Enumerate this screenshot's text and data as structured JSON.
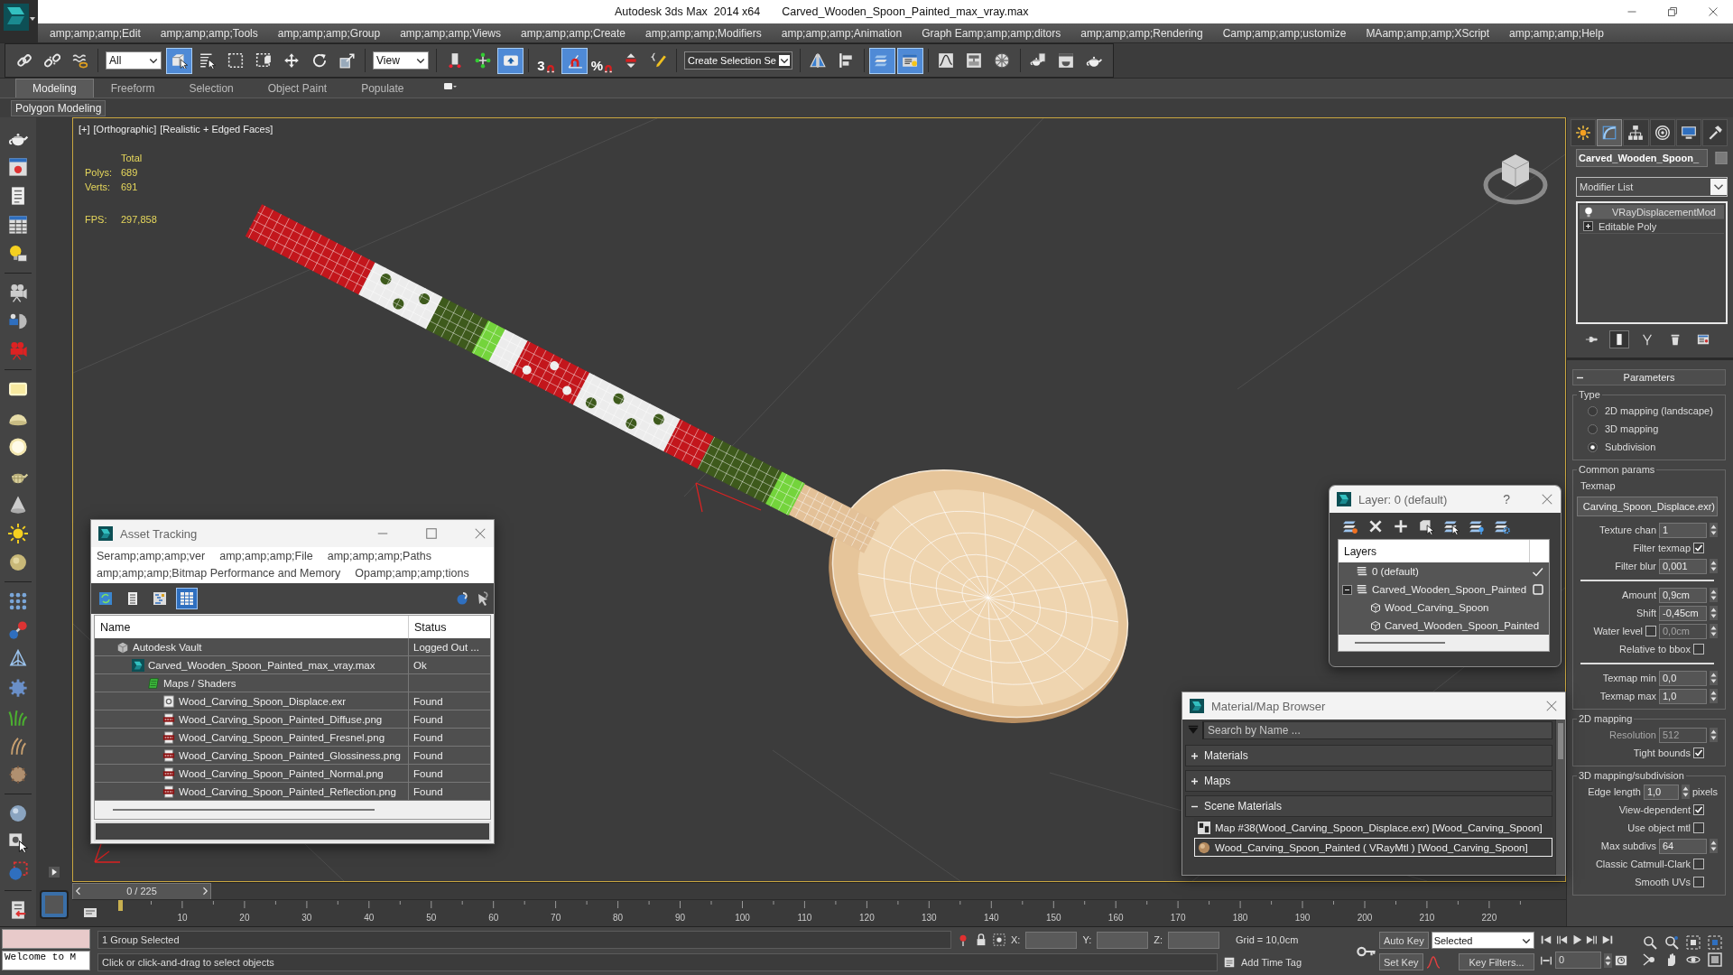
{
  "title_bar": {
    "app": "Autodesk 3ds Max  2014 x64",
    "file": "Carved_Wooden_Spoon_Painted_max_vray.max"
  },
  "menu": [
    "amp;amp;amp;Edit",
    "amp;amp;amp;Tools",
    "amp;amp;amp;Group",
    "amp;amp;amp;Views",
    "amp;amp;amp;Create",
    "amp;amp;amp;Modifiers",
    "amp;amp;amp;Animation",
    "Graph Eamp;amp;amp;ditors",
    "amp;amp;amp;Rendering",
    "Camp;amp;amp;ustomize",
    "MAamp;amp;amp;XScript",
    "amp;amp;amp;Help"
  ],
  "toolbar": [
    {
      "kind": "button",
      "selected": false
    },
    {
      "kind": "button",
      "selected": false
    },
    {
      "kind": "button",
      "selected": false
    },
    {
      "kind": "dropdown",
      "value": "All"
    },
    {
      "kind": "button",
      "selected": true
    },
    {
      "kind": "button",
      "selected": false
    },
    {
      "kind": "button",
      "selected": false
    },
    {
      "kind": "button",
      "selected": false
    },
    {
      "kind": "button",
      "selected": false
    },
    {
      "kind": "button",
      "selected": false
    },
    {
      "kind": "button",
      "selected": false
    },
    {
      "kind": "dropdown",
      "value": "View"
    },
    {
      "kind": "button",
      "selected": false
    },
    {
      "kind": "button",
      "selected": false
    },
    {
      "kind": "button",
      "selected": true
    },
    {
      "kind": "snap",
      "label": "3",
      "selected": false
    },
    {
      "kind": "button",
      "selected": true
    },
    {
      "kind": "snap",
      "label": "%",
      "selected": false
    },
    {
      "kind": "button",
      "selected": false
    },
    {
      "kind": "button",
      "selected": false
    },
    {
      "kind": "dropdown",
      "value": "Create Selection Se"
    },
    {
      "kind": "button",
      "selected": false
    },
    {
      "kind": "button",
      "selected": false
    },
    {
      "kind": "button",
      "selected": true
    },
    {
      "kind": "button",
      "selected": true
    },
    {
      "kind": "button",
      "selected": false
    },
    {
      "kind": "button",
      "selected": false
    },
    {
      "kind": "button",
      "selected": false
    },
    {
      "kind": "button",
      "selected": false
    },
    {
      "kind": "button",
      "selected": false
    },
    {
      "kind": "button",
      "selected": false
    }
  ],
  "ribbon": {
    "tabs": [
      {
        "label": "Modeling",
        "selected": true
      },
      {
        "label": "Freeform",
        "selected": false
      },
      {
        "label": "Selection",
        "selected": false
      },
      {
        "label": "Object Paint",
        "selected": false
      },
      {
        "label": "Populate",
        "selected": false
      }
    ],
    "panel": "Polygon Modeling"
  },
  "viewport": {
    "labels": [
      "[+]",
      "[Orthographic]",
      "[Realistic + Edged Faces]"
    ],
    "stats_heading": "Total",
    "stats": [
      {
        "kind": "count",
        "label": "Polys:",
        "value": "689"
      },
      {
        "kind": "count",
        "label": "Verts:",
        "value": "691"
      },
      {
        "kind": "rate",
        "label": "FPS:",
        "value": "297,858"
      }
    ]
  },
  "asset_tracking": {
    "title": "Asset Tracking",
    "menu": [
      "Seramp;amp;amp;ver",
      "amp;amp;amp;File",
      "amp;amp;amp;Paths",
      "amp;amp;amp;Bitmap Performance and Memory",
      "Opamp;amp;amp;tions"
    ],
    "view_buttons": [
      {
        "selected": false
      },
      {
        "selected": false
      },
      {
        "selected": false
      },
      {
        "selected": true
      }
    ],
    "columns": [
      "Name",
      "Status"
    ],
    "tree": [
      {
        "kind": "vault",
        "name": "Autodesk Vault",
        "status": "Logged Out ...",
        "children": [
          {
            "kind": "scene",
            "name": "Carved_Wooden_Spoon_Painted_max_vray.max",
            "status": "Ok",
            "children": [
              {
                "kind": "folder",
                "name": "Maps / Shaders",
                "children": [
                  {
                    "kind": "exr",
                    "name": "Wood_Carving_Spoon_Displace.exr",
                    "status": "Found"
                  },
                  {
                    "kind": "png",
                    "name": "Wood_Carving_Spoon_Painted_Diffuse.png",
                    "status": "Found"
                  },
                  {
                    "kind": "png",
                    "name": "Wood_Carving_Spoon_Painted_Fresnel.png",
                    "status": "Found"
                  },
                  {
                    "kind": "png",
                    "name": "Wood_Carving_Spoon_Painted_Glossiness.png",
                    "status": "Found"
                  },
                  {
                    "kind": "png",
                    "name": "Wood_Carving_Spoon_Painted_Normal.png",
                    "status": "Found"
                  },
                  {
                    "kind": "png",
                    "name": "Wood_Carving_Spoon_Painted_Reflection.png",
                    "status": "Found"
                  }
                ]
              }
            ]
          }
        ]
      }
    ]
  },
  "layer_dialog": {
    "title": "Layer: 0 (default)",
    "help": "?",
    "header": "Layers",
    "layers": [
      {
        "kind": "layer",
        "name": "0 (default)",
        "current": true
      },
      {
        "kind": "layer",
        "name": "Carved_Wooden_Spoon_Painted",
        "current": false,
        "expanded": true,
        "children": [
          {
            "kind": "object",
            "name": "Wood_Carving_Spoon"
          },
          {
            "kind": "object",
            "name": "Carved_Wooden_Spoon_Painted"
          }
        ]
      }
    ]
  },
  "material_browser": {
    "title": "Material/Map Browser",
    "search": {
      "placeholder": "Search by Name ..."
    },
    "groups": [
      {
        "label": "Materials",
        "expanded": false
      },
      {
        "label": "Maps",
        "expanded": false
      },
      {
        "label": "Scene Materials",
        "expanded": true,
        "items": [
          {
            "kind": "map",
            "label": "Map #38(Wood_Carving_Spoon_Displace.exr) [Wood_Carving_Spoon]",
            "selected": false
          },
          {
            "kind": "material",
            "label": "Wood_Carving_Spoon_Painted ( VRayMtl ) [Wood_Carving_Spoon]",
            "selected": true
          }
        ]
      }
    ]
  },
  "command_panel": {
    "tabs": [
      {
        "selected": false
      },
      {
        "selected": true
      },
      {
        "selected": false
      },
      {
        "selected": false
      },
      {
        "selected": false
      },
      {
        "selected": false
      }
    ],
    "object_name": "Carved_Wooden_Spoon_",
    "modifier_list": "Modifier List",
    "stack": [
      {
        "kind": "modifier",
        "label": "VRayDisplacementMod",
        "on": true,
        "selected": true
      },
      {
        "kind": "object",
        "label": "Editable Poly",
        "expanded": false,
        "selected": false
      }
    ],
    "stack_buttons": [
      {
        "selected": false
      },
      {
        "selected": true
      },
      {
        "selected": false
      },
      {
        "selected": false
      },
      {
        "selected": false
      }
    ],
    "rollout": {
      "title": "Parameters",
      "expanded": true
    },
    "groups": [
      {
        "kind": "radio",
        "title": "Type",
        "options": [
          {
            "label": "2D mapping (landscape)",
            "selected": false
          },
          {
            "label": "3D mapping",
            "selected": false
          },
          {
            "label": "Subdivision",
            "selected": true
          }
        ]
      },
      {
        "kind": "params",
        "title": "Common params",
        "texmap_label": "Texmap",
        "texmap": "Carving_Spoon_Displace.exr)",
        "sections": [
          [
            {
              "kind": "spinner",
              "label": "Texture chan",
              "value": "1"
            },
            {
              "kind": "checkbox",
              "label": "Filter texmap",
              "checked": true
            },
            {
              "kind": "spinner",
              "label": "Filter blur",
              "value": "0,001"
            }
          ],
          [
            {
              "kind": "spinner",
              "label": "Amount",
              "value": "0,9cm"
            },
            {
              "kind": "spinner",
              "label": "Shift",
              "value": "-0,45cm"
            },
            {
              "kind": "checkspinner",
              "label": "Water level",
              "checked": false,
              "value": "0,0cm"
            },
            {
              "kind": "checkbox",
              "label": "Relative to bbox",
              "checked": false
            }
          ],
          [
            {
              "kind": "spinner",
              "label": "Texmap min",
              "value": "0,0"
            },
            {
              "kind": "spinner",
              "label": "Texmap max",
              "value": "1,0"
            }
          ]
        ]
      },
      {
        "kind": "params",
        "title": "2D mapping",
        "sections": [
          [
            {
              "kind": "spinner",
              "label": "Resolution",
              "value": "512",
              "disabled": true
            },
            {
              "kind": "checkbox",
              "label": "Tight bounds",
              "checked": true,
              "disabled": false
            }
          ]
        ]
      },
      {
        "kind": "params",
        "title": "3D mapping/subdivision",
        "sections": [
          [
            {
              "kind": "spinner",
              "label": "Edge length",
              "value": "1,0",
              "unit": "pixels"
            },
            {
              "kind": "checkbox",
              "label": "View-dependent",
              "checked": true
            },
            {
              "kind": "checkbox",
              "label": "Use object mtl",
              "checked": false
            },
            {
              "kind": "spinner",
              "label": "Max subdivs",
              "value": "64"
            },
            {
              "kind": "checkbox",
              "label": "Classic Catmull-Clark",
              "checked": false
            },
            {
              "kind": "checkbox",
              "label": "Smooth UVs",
              "checked": false
            }
          ]
        ]
      }
    ]
  },
  "timeline": {
    "position": "0 / 225",
    "level": 0,
    "labels": [
      "10",
      "20",
      "30",
      "40",
      "50",
      "60",
      "70",
      "80",
      "90",
      "100",
      "110",
      "120",
      "130",
      "140",
      "150",
      "160",
      "170",
      "180",
      "190",
      "200",
      "210",
      "220"
    ]
  },
  "status_bar": {
    "listener_output": "Welcome to M",
    "selection": "1 Group Selected",
    "axes": [
      "X:",
      "Y:",
      "Z:"
    ],
    "grid": "Grid = 10,0cm",
    "prompt": "Click or click-and-drag to select objects",
    "time_tag": "Add Time Tag",
    "auto_key": {
      "label": "Auto Key",
      "on": false
    },
    "key_mode": "Selected",
    "set_key": "Set Key",
    "key_filters": "Key Filters...",
    "frame": "0"
  }
}
